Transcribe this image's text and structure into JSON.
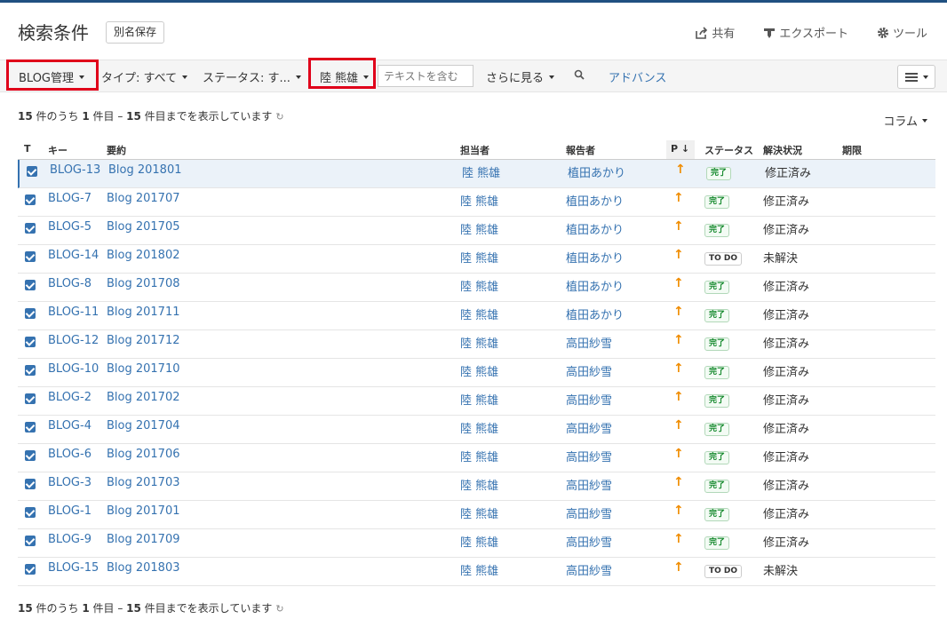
{
  "header": {
    "title": "検索条件",
    "save_as": "別名保存",
    "actions": [
      {
        "label": "共有",
        "icon": "share-icon"
      },
      {
        "label": "エクスポート",
        "icon": "export-icon"
      },
      {
        "label": "ツール",
        "icon": "gear-icon"
      }
    ]
  },
  "filters": {
    "project": "BLOG管理",
    "type": "タイプ: すべて",
    "status": "ステータス: す...",
    "assignee": "陸 熊雄",
    "text_placeholder": "テキストを含む",
    "more": "さらに見る",
    "advanced": "アドバンス"
  },
  "colors": {
    "accent": "#3572b0",
    "highlight": "#e0001a",
    "priority": "#f08c00",
    "done": "#14892c"
  },
  "results": {
    "count_top": {
      "total": "15",
      "mid1": " 件のうち ",
      "from": "1",
      "mid2": " 件目 – ",
      "to": "15",
      "suffix": " 件目までを表示しています"
    },
    "columns_label": "コラム"
  },
  "table": {
    "headers": {
      "type": "T",
      "key": "キー",
      "summary": "要約",
      "assignee": "担当者",
      "reporter": "報告者",
      "priority": "P",
      "status": "ステータス",
      "resolution": "解決状況",
      "due": "期限"
    },
    "rows": [
      {
        "key": "BLOG-13",
        "summary": "Blog 201801",
        "assignee": "陸 熊雄",
        "reporter": "植田あかり",
        "status": "完了",
        "resolution": "修正済み"
      },
      {
        "key": "BLOG-7",
        "summary": "Blog 201707",
        "assignee": "陸 熊雄",
        "reporter": "植田あかり",
        "status": "完了",
        "resolution": "修正済み"
      },
      {
        "key": "BLOG-5",
        "summary": "Blog 201705",
        "assignee": "陸 熊雄",
        "reporter": "植田あかり",
        "status": "完了",
        "resolution": "修正済み"
      },
      {
        "key": "BLOG-14",
        "summary": "Blog 201802",
        "assignee": "陸 熊雄",
        "reporter": "植田あかり",
        "status": "TO DO",
        "resolution": "未解決"
      },
      {
        "key": "BLOG-8",
        "summary": "Blog 201708",
        "assignee": "陸 熊雄",
        "reporter": "植田あかり",
        "status": "完了",
        "resolution": "修正済み"
      },
      {
        "key": "BLOG-11",
        "summary": "Blog 201711",
        "assignee": "陸 熊雄",
        "reporter": "植田あかり",
        "status": "完了",
        "resolution": "修正済み"
      },
      {
        "key": "BLOG-12",
        "summary": "Blog 201712",
        "assignee": "陸 熊雄",
        "reporter": "高田紗雪",
        "status": "完了",
        "resolution": "修正済み"
      },
      {
        "key": "BLOG-10",
        "summary": "Blog 201710",
        "assignee": "陸 熊雄",
        "reporter": "高田紗雪",
        "status": "完了",
        "resolution": "修正済み"
      },
      {
        "key": "BLOG-2",
        "summary": "Blog 201702",
        "assignee": "陸 熊雄",
        "reporter": "高田紗雪",
        "status": "完了",
        "resolution": "修正済み"
      },
      {
        "key": "BLOG-4",
        "summary": "Blog 201704",
        "assignee": "陸 熊雄",
        "reporter": "高田紗雪",
        "status": "完了",
        "resolution": "修正済み"
      },
      {
        "key": "BLOG-6",
        "summary": "Blog 201706",
        "assignee": "陸 熊雄",
        "reporter": "高田紗雪",
        "status": "完了",
        "resolution": "修正済み"
      },
      {
        "key": "BLOG-3",
        "summary": "Blog 201703",
        "assignee": "陸 熊雄",
        "reporter": "高田紗雪",
        "status": "完了",
        "resolution": "修正済み"
      },
      {
        "key": "BLOG-1",
        "summary": "Blog 201701",
        "assignee": "陸 熊雄",
        "reporter": "高田紗雪",
        "status": "完了",
        "resolution": "修正済み"
      },
      {
        "key": "BLOG-9",
        "summary": "Blog 201709",
        "assignee": "陸 熊雄",
        "reporter": "高田紗雪",
        "status": "完了",
        "resolution": "修正済み"
      },
      {
        "key": "BLOG-15",
        "summary": "Blog 201803",
        "assignee": "陸 熊雄",
        "reporter": "高田紗雪",
        "status": "TO DO",
        "resolution": "未解決"
      }
    ]
  }
}
